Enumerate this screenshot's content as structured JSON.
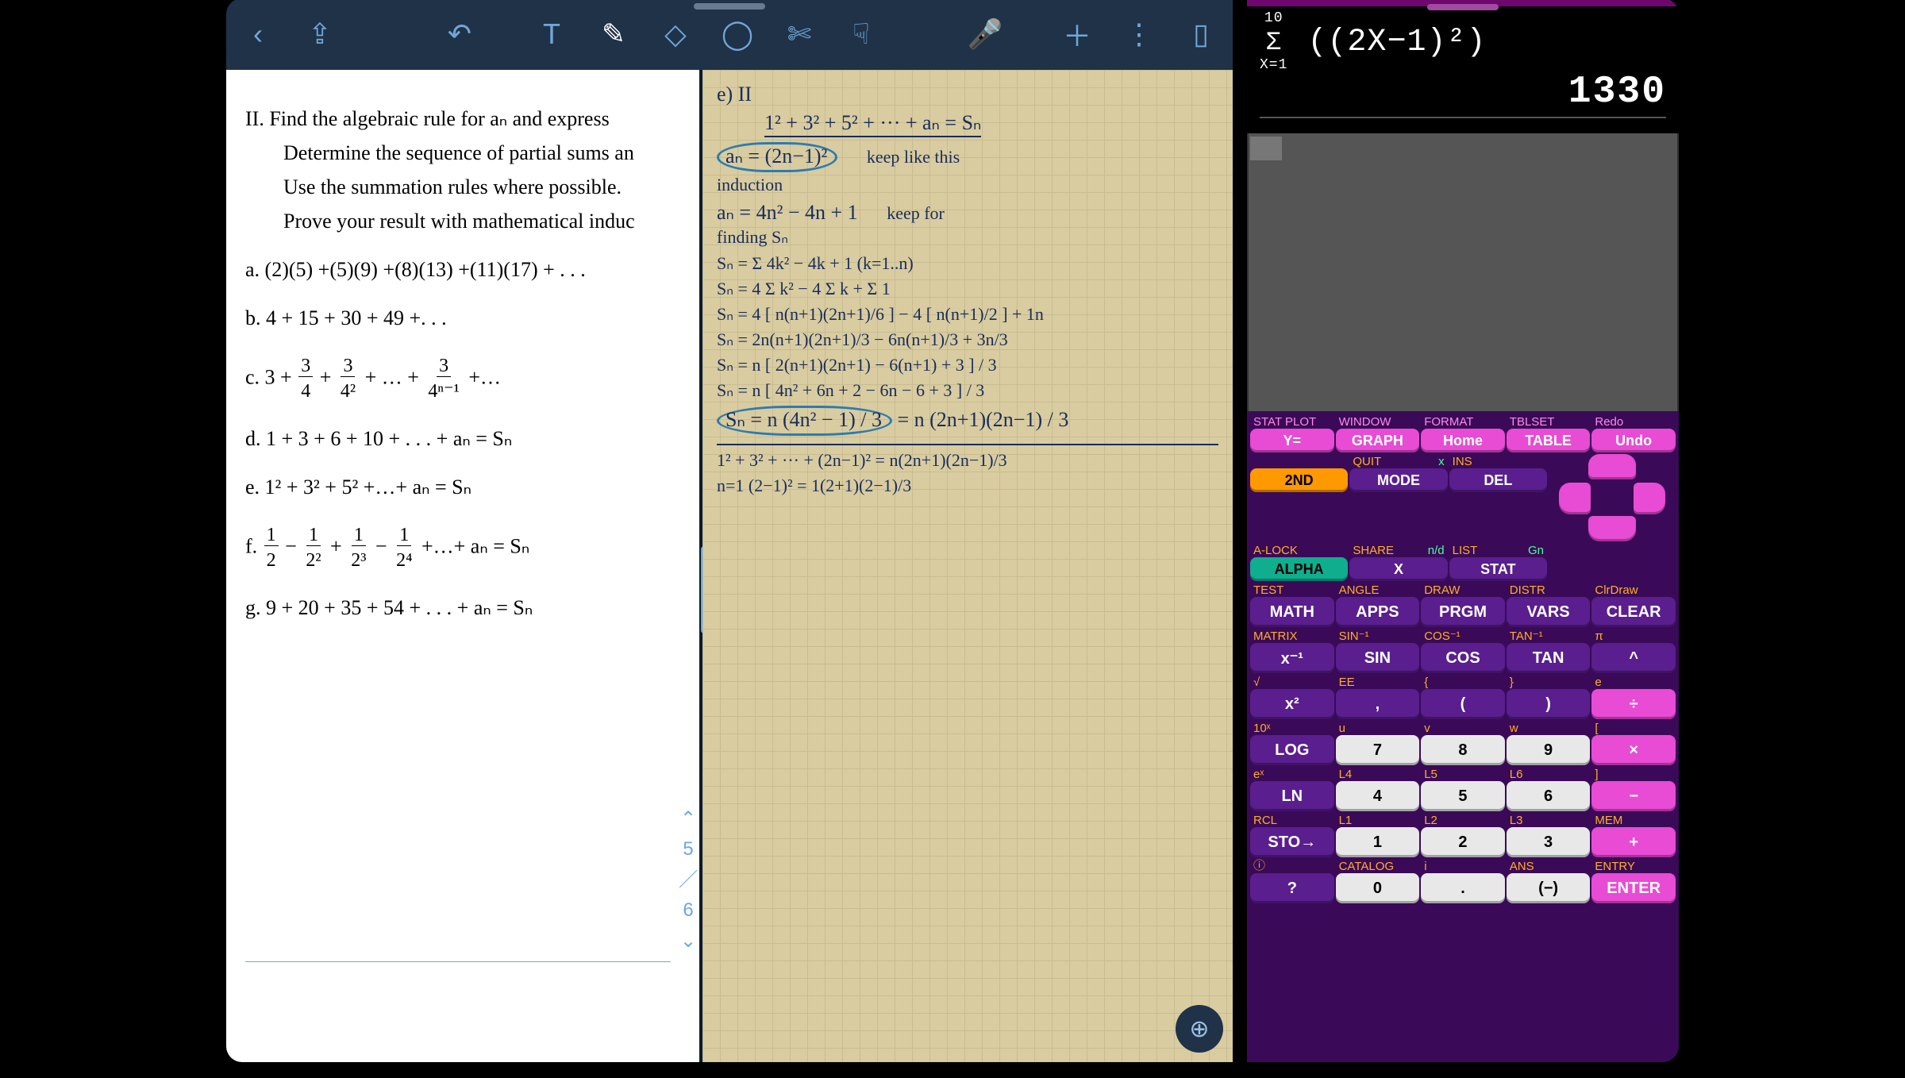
{
  "left_app": {
    "toolbar": {
      "back": "‹",
      "share": "⇪",
      "undo": "↶",
      "text_tool": "T",
      "pen_tool": "✎",
      "highlighter_tool": "◇",
      "eraser_tool": "◯",
      "scissors_tool": "✄",
      "smudge_tool": "☟",
      "mic_tool": "🎤",
      "add": "＋",
      "more": "⋮",
      "pages": "▯"
    },
    "problem": {
      "heading": "II.  Find the algebraic rule for aₙ and express",
      "sub1": "Determine the sequence of partial sums an",
      "sub2": "Use the summation rules where possible.",
      "sub3": "Prove your result with mathematical induc",
      "a": "a.   (2)(5) +(5)(9) +(8)(13) +(11)(17) + . . .",
      "b": "b.   4 + 15 + 30 + 49 +. . .",
      "c_lead": "c.   3 +",
      "c_tail": " + … +",
      "c_end": " +…",
      "d": "d.   1 + 3 + 6 + 10 + . . .  + aₙ = Sₙ",
      "e": "e.   1² + 3² + 5² +…+ aₙ = Sₙ",
      "f_lead": "f.   ",
      "f_tail": " +…+ aₙ = Sₙ",
      "g": "g.   9  +  20  +  35  +  54  + . . .   +  aₙ  = Sₙ"
    },
    "page_nav": {
      "up": "⌃",
      "current": "5",
      "sep": "／",
      "total": "6",
      "down": "⌄"
    },
    "handwriting": {
      "l0": "e) II",
      "l1": "1² + 3² + 5² + ··· + aₙ = Sₙ",
      "l2_left": "aₙ = (2n−1)²",
      "l2_right": "keep like this\ninduction",
      "l3_left": "aₙ = 4n² − 4n + 1",
      "l3_right": "keep for\nfinding Sₙ",
      "l4": "Sₙ = Σ 4k² − 4k + 1   (k=1..n)",
      "l5": "Sₙ =  4 Σ k²  − 4 Σ k  +  Σ 1",
      "l6": "Sₙ = 4 [ n(n+1)(2n+1)/6 ]  − 4 [ n(n+1)/2 ]  + 1n",
      "l7": "Sₙ =  2n(n+1)(2n+1)/3  −  6n(n+1)/3  +  3n/3",
      "l8": "Sₙ =  n [ 2(n+1)(2n+1) − 6(n+1) + 3 ] / 3",
      "l9": "Sₙ =  n [ 4n² + 6n + 2 − 6n − 6 + 3 ] / 3",
      "l10_left": "Sₙ =  n (4n² − 1) / 3",
      "l10_right": " =  n (2n+1)(2n−1) / 3",
      "l11": "1² + 3² + ··· + (2n−1)²  =  n(2n+1)(2n−1)/3",
      "l12": "n=1    (2−1)²  =  1(2+1)(2−1)/3"
    },
    "zoom": "⊕"
  },
  "calc": {
    "expr_upper": "10",
    "expr_sigma": "Σ",
    "expr_lower": "X=1",
    "expr_body": "((2X−1)²)",
    "answer": "1330",
    "key_rows": [
      {
        "type": "menu",
        "cells": [
          {
            "top": "STAT PLOT",
            "label": "Y=",
            "cls": "k-mag"
          },
          {
            "top": "WINDOW",
            "label": "GRAPH",
            "cls": "k-mag"
          },
          {
            "top": "FORMAT",
            "label": "Home",
            "cls": "k-mag"
          },
          {
            "top": "TBLSET",
            "label": "TABLE",
            "cls": "k-mag"
          },
          {
            "top": "Redo",
            "label": "Undo",
            "cls": "k-mag"
          }
        ]
      },
      {
        "type": "sys",
        "cells": [
          {
            "top_y": "",
            "label": "2ND",
            "cls": "k-orange"
          },
          {
            "top_y": "QUIT",
            "top_g": "x",
            "label": "MODE",
            "cls": "k-purple"
          },
          {
            "top_y": "INS",
            "label": "DEL",
            "cls": "k-purple"
          }
        ],
        "dpad": true
      },
      {
        "type": "sys",
        "cells": [
          {
            "top_y": "A-LOCK",
            "label": "ALPHA",
            "cls": "k-teal"
          },
          {
            "top_y": "SHARE",
            "top_g": "n/d",
            "label": "X",
            "cls": "k-purple"
          },
          {
            "top_y": "LIST",
            "top_g": "Gn",
            "label": "STAT",
            "cls": "k-purple"
          }
        ],
        "dpad": true
      },
      {
        "type": "fn",
        "cells": [
          {
            "top_y": "TEST",
            "label": "MATH",
            "cls": "k-purple"
          },
          {
            "top_y": "ANGLE",
            "label": "APPS",
            "cls": "k-purple"
          },
          {
            "top_y": "DRAW",
            "label": "PRGM",
            "cls": "k-purple"
          },
          {
            "top_y": "DISTR",
            "label": "VARS",
            "cls": "k-purple"
          },
          {
            "top_y": "ClrDraw",
            "label": "CLEAR",
            "cls": "k-purple"
          }
        ]
      },
      {
        "type": "fn",
        "cells": [
          {
            "top_y": "MATRIX",
            "label": "x⁻¹",
            "cls": "k-purple"
          },
          {
            "top_y": "SIN⁻¹",
            "label": "SIN",
            "cls": "k-purple"
          },
          {
            "top_y": "COS⁻¹",
            "label": "COS",
            "cls": "k-purple"
          },
          {
            "top_y": "TAN⁻¹",
            "label": "TAN",
            "cls": "k-purple"
          },
          {
            "top_y": "π",
            "label": "^",
            "cls": "k-purple"
          }
        ]
      },
      {
        "type": "fn",
        "cells": [
          {
            "top_y": "√",
            "label": "x²",
            "cls": "k-purple"
          },
          {
            "top_y": "EE",
            "label": ",",
            "cls": "k-purple"
          },
          {
            "top_y": "{",
            "label": "(",
            "cls": "k-purple"
          },
          {
            "top_y": "}",
            "label": ")",
            "cls": "k-purple"
          },
          {
            "top_y": "e",
            "label": "÷",
            "cls": "k-mag"
          }
        ]
      },
      {
        "type": "num",
        "cells": [
          {
            "top_y": "10ˣ",
            "label": "LOG",
            "cls": "k-purple"
          },
          {
            "top_y": "u",
            "label": "7",
            "cls": "k-white"
          },
          {
            "top_y": "v",
            "label": "8",
            "cls": "k-white"
          },
          {
            "top_y": "w",
            "label": "9",
            "cls": "k-white"
          },
          {
            "top_y": "[",
            "label": "×",
            "cls": "k-mag"
          }
        ]
      },
      {
        "type": "num",
        "cells": [
          {
            "top_y": "eˣ",
            "label": "LN",
            "cls": "k-purple"
          },
          {
            "top_y": "L4",
            "label": "4",
            "cls": "k-white"
          },
          {
            "top_y": "L5",
            "label": "5",
            "cls": "k-white"
          },
          {
            "top_y": "L6",
            "label": "6",
            "cls": "k-white"
          },
          {
            "top_y": "]",
            "label": "−",
            "cls": "k-mag"
          }
        ]
      },
      {
        "type": "num",
        "cells": [
          {
            "top_y": "RCL",
            "label": "STO→",
            "cls": "k-purple"
          },
          {
            "top_y": "L1",
            "label": "1",
            "cls": "k-white"
          },
          {
            "top_y": "L2",
            "label": "2",
            "cls": "k-white"
          },
          {
            "top_y": "L3",
            "label": "3",
            "cls": "k-white"
          },
          {
            "top_y": "MEM",
            "label": "+",
            "cls": "k-mag"
          }
        ]
      },
      {
        "type": "num",
        "cells": [
          {
            "top_y": "ⓘ",
            "label": "?",
            "cls": "k-purple"
          },
          {
            "top_y": "CATALOG",
            "label": "0",
            "cls": "k-white"
          },
          {
            "top_y": "i",
            "label": ".",
            "cls": "k-white"
          },
          {
            "top_y": "ANS",
            "label": "(−)",
            "cls": "k-white"
          },
          {
            "top_y": "ENTRY",
            "label": "ENTER",
            "cls": "k-mag"
          }
        ]
      }
    ]
  }
}
